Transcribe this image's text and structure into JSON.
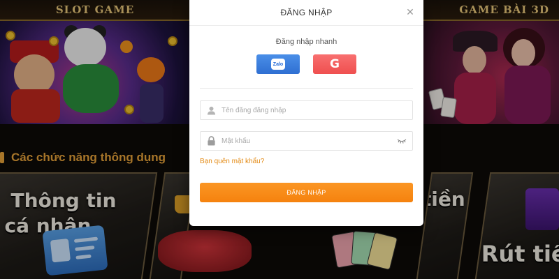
{
  "background": {
    "banners": {
      "slot_caption": "SLOT GAME",
      "bai_caption": "GAME BÀI 3D"
    },
    "section_title": "Các chức năng thông dụng",
    "tiles": {
      "profile_line1": "Thông tin",
      "profile_line2": "cá nhân",
      "deposit_partial": "tiền",
      "withdraw_partial": "Rút tiền"
    }
  },
  "modal": {
    "title": "ĐĂNG NHẬP",
    "close_symbol": "✕",
    "quick_login_label": "Đăng nhập nhanh",
    "zalo_label": "Zalo",
    "google_label": "G",
    "username": {
      "value": "",
      "placeholder": "Tên đăng đăng nhập"
    },
    "password": {
      "value": "",
      "placeholder": "Mật khẩu"
    },
    "forgot_password": "Bạn quên mật khẩu?",
    "submit_label": "ĐĂNG NHẬP"
  },
  "colors": {
    "accent_orange": "#f5820e",
    "zalo_blue": "#2f6fd2",
    "google_red": "#ef4f4f",
    "section_gold": "#e8a23a"
  },
  "icons": {
    "close": "close-icon",
    "user": "user-icon",
    "lock": "lock-icon",
    "eye": "eye-closed-icon",
    "google": "google-icon",
    "zalo": "zalo-icon"
  }
}
